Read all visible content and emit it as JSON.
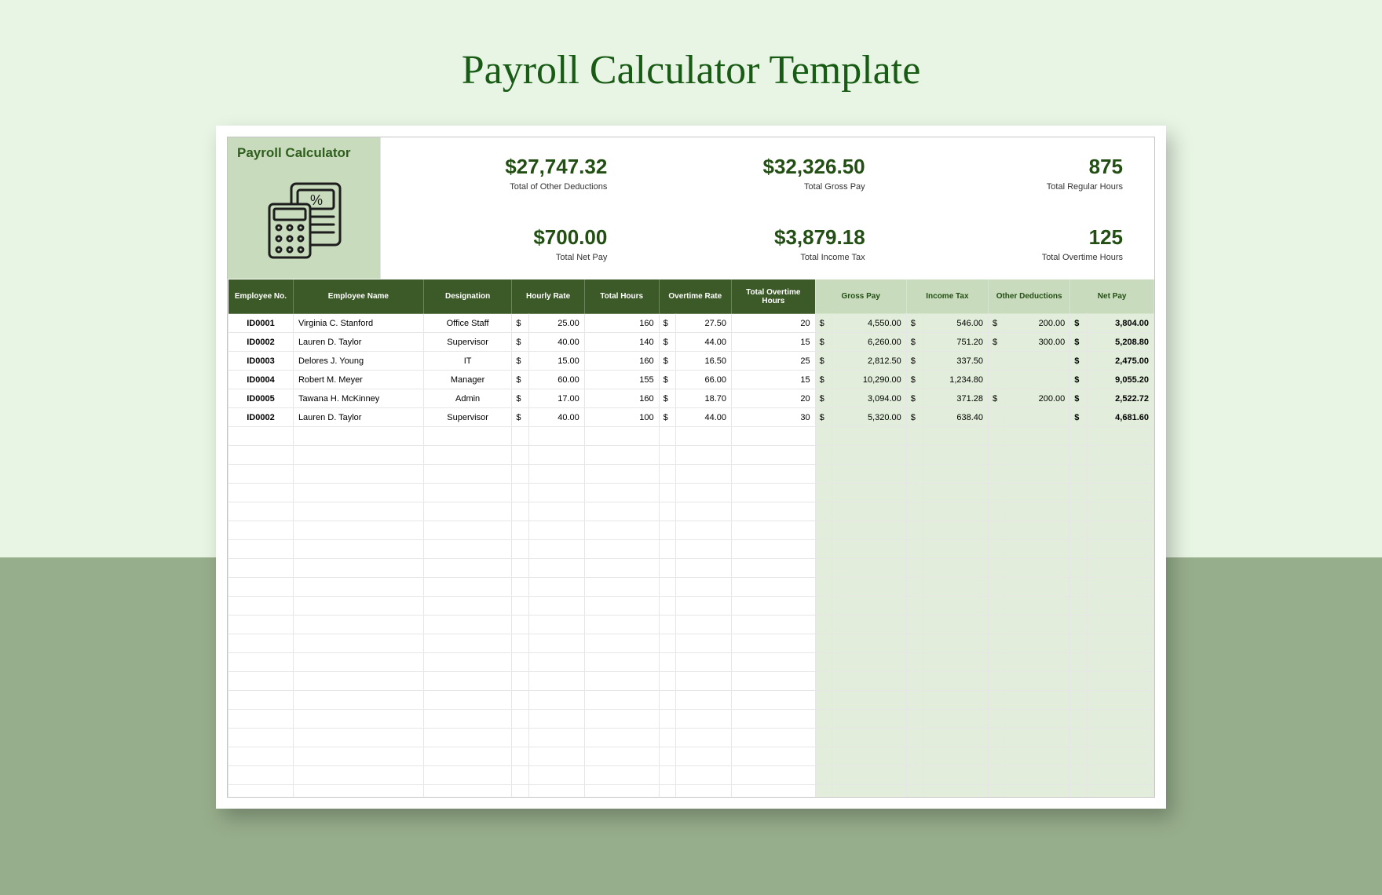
{
  "page_title": "Payroll Calculator Template",
  "sheet_title": "Payroll Calculator",
  "stats": [
    {
      "value": "$27,747.32",
      "label": "Total of Other Deductions"
    },
    {
      "value": "$32,326.50",
      "label": "Total Gross Pay"
    },
    {
      "value": "875",
      "label": "Total Regular Hours"
    },
    {
      "value": "$700.00",
      "label": "Total Net Pay"
    },
    {
      "value": "$3,879.18",
      "label": "Total Income Tax"
    },
    {
      "value": "125",
      "label": "Total Overtime Hours"
    }
  ],
  "columns": {
    "emp_no": "Employee No.",
    "emp_name": "Employee Name",
    "designation": "Designation",
    "hourly_rate": "Hourly Rate",
    "total_hours": "Total Hours",
    "overtime_rate": "Overtime Rate",
    "tot_ot_hours": "Total Overtime Hours",
    "gross_pay": "Gross Pay",
    "income_tax": "Income Tax",
    "other_ded": "Other Deductions",
    "net_pay": "Net Pay"
  },
  "currency_symbol": "$",
  "rows": [
    {
      "id": "ID0001",
      "name": "Virginia C. Stanford",
      "des": "Office Staff",
      "rate": "25.00",
      "hours": "160",
      "orate": "27.50",
      "ohours": "20",
      "gross": "4,550.00",
      "tax": "546.00",
      "ded": "200.00",
      "net": "3,804.00"
    },
    {
      "id": "ID0002",
      "name": "Lauren D. Taylor",
      "des": "Supervisor",
      "rate": "40.00",
      "hours": "140",
      "orate": "44.00",
      "ohours": "15",
      "gross": "6,260.00",
      "tax": "751.20",
      "ded": "300.00",
      "net": "5,208.80"
    },
    {
      "id": "ID0003",
      "name": "Delores J. Young",
      "des": "IT",
      "rate": "15.00",
      "hours": "160",
      "orate": "16.50",
      "ohours": "25",
      "gross": "2,812.50",
      "tax": "337.50",
      "ded": "",
      "net": "2,475.00"
    },
    {
      "id": "ID0004",
      "name": "Robert M. Meyer",
      "des": "Manager",
      "rate": "60.00",
      "hours": "155",
      "orate": "66.00",
      "ohours": "15",
      "gross": "10,290.00",
      "tax": "1,234.80",
      "ded": "",
      "net": "9,055.20"
    },
    {
      "id": "ID0005",
      "name": "Tawana H. McKinney",
      "des": "Admin",
      "rate": "17.00",
      "hours": "160",
      "orate": "18.70",
      "ohours": "20",
      "gross": "3,094.00",
      "tax": "371.28",
      "ded": "200.00",
      "net": "2,522.72"
    },
    {
      "id": "ID0002",
      "name": "Lauren D. Taylor",
      "des": "Supervisor",
      "rate": "40.00",
      "hours": "100",
      "orate": "44.00",
      "ohours": "30",
      "gross": "5,320.00",
      "tax": "638.40",
      "ded": "",
      "net": "4,681.60"
    }
  ],
  "empty_rows": 22
}
